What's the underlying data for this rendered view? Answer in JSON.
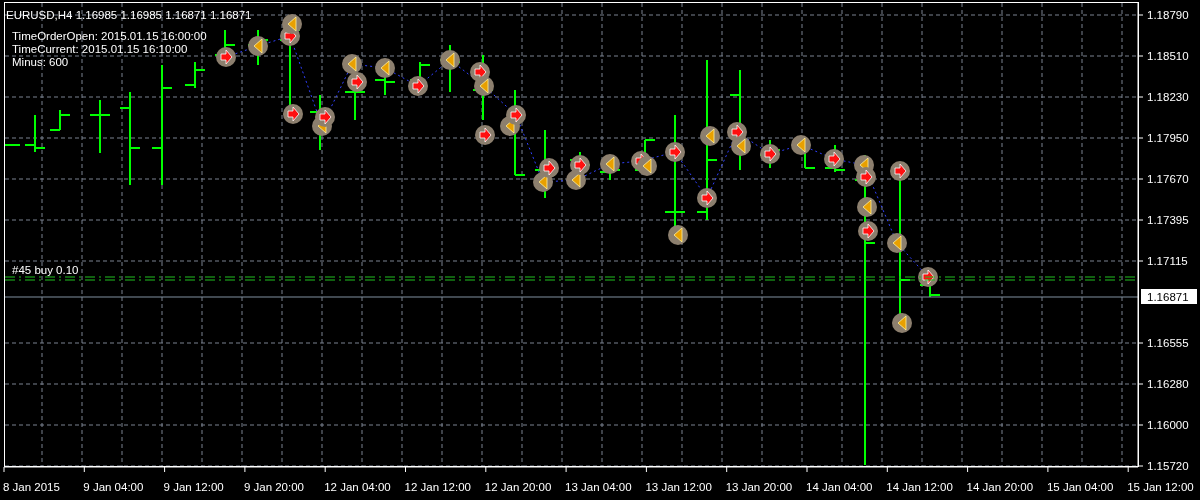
{
  "chart": {
    "header": "EURUSD,H4  1.16985 1.16985 1.16871 1.16871",
    "info_lines": [
      "TimeOrderOpen:  2015.01.15 16:00:00",
      "TimeCurrent: 2015.01.15 16:10:00",
      "Minus:  600"
    ],
    "order_label": "#45 buy 0.10",
    "price_tag": "1.16871",
    "price_axis": [
      "1.18790",
      "1.18510",
      "1.18230",
      "1.17950",
      "1.17670",
      "1.17395",
      "1.17115",
      "1.16555",
      "1.16280",
      "1.16000",
      "1.15720"
    ],
    "time_axis": [
      "8 Jan 2015",
      "9 Jan 04:00",
      "9 Jan 12:00",
      "9 Jan 20:00",
      "12 Jan 04:00",
      "12 Jan 12:00",
      "12 Jan 20:00",
      "13 Jan 04:00",
      "13 Jan 12:00",
      "13 Jan 20:00",
      "14 Jan 04:00",
      "14 Jan 12:00",
      "14 Jan 20:00",
      "15 Jan 04:00",
      "15 Jan 12:00"
    ]
  }
}
